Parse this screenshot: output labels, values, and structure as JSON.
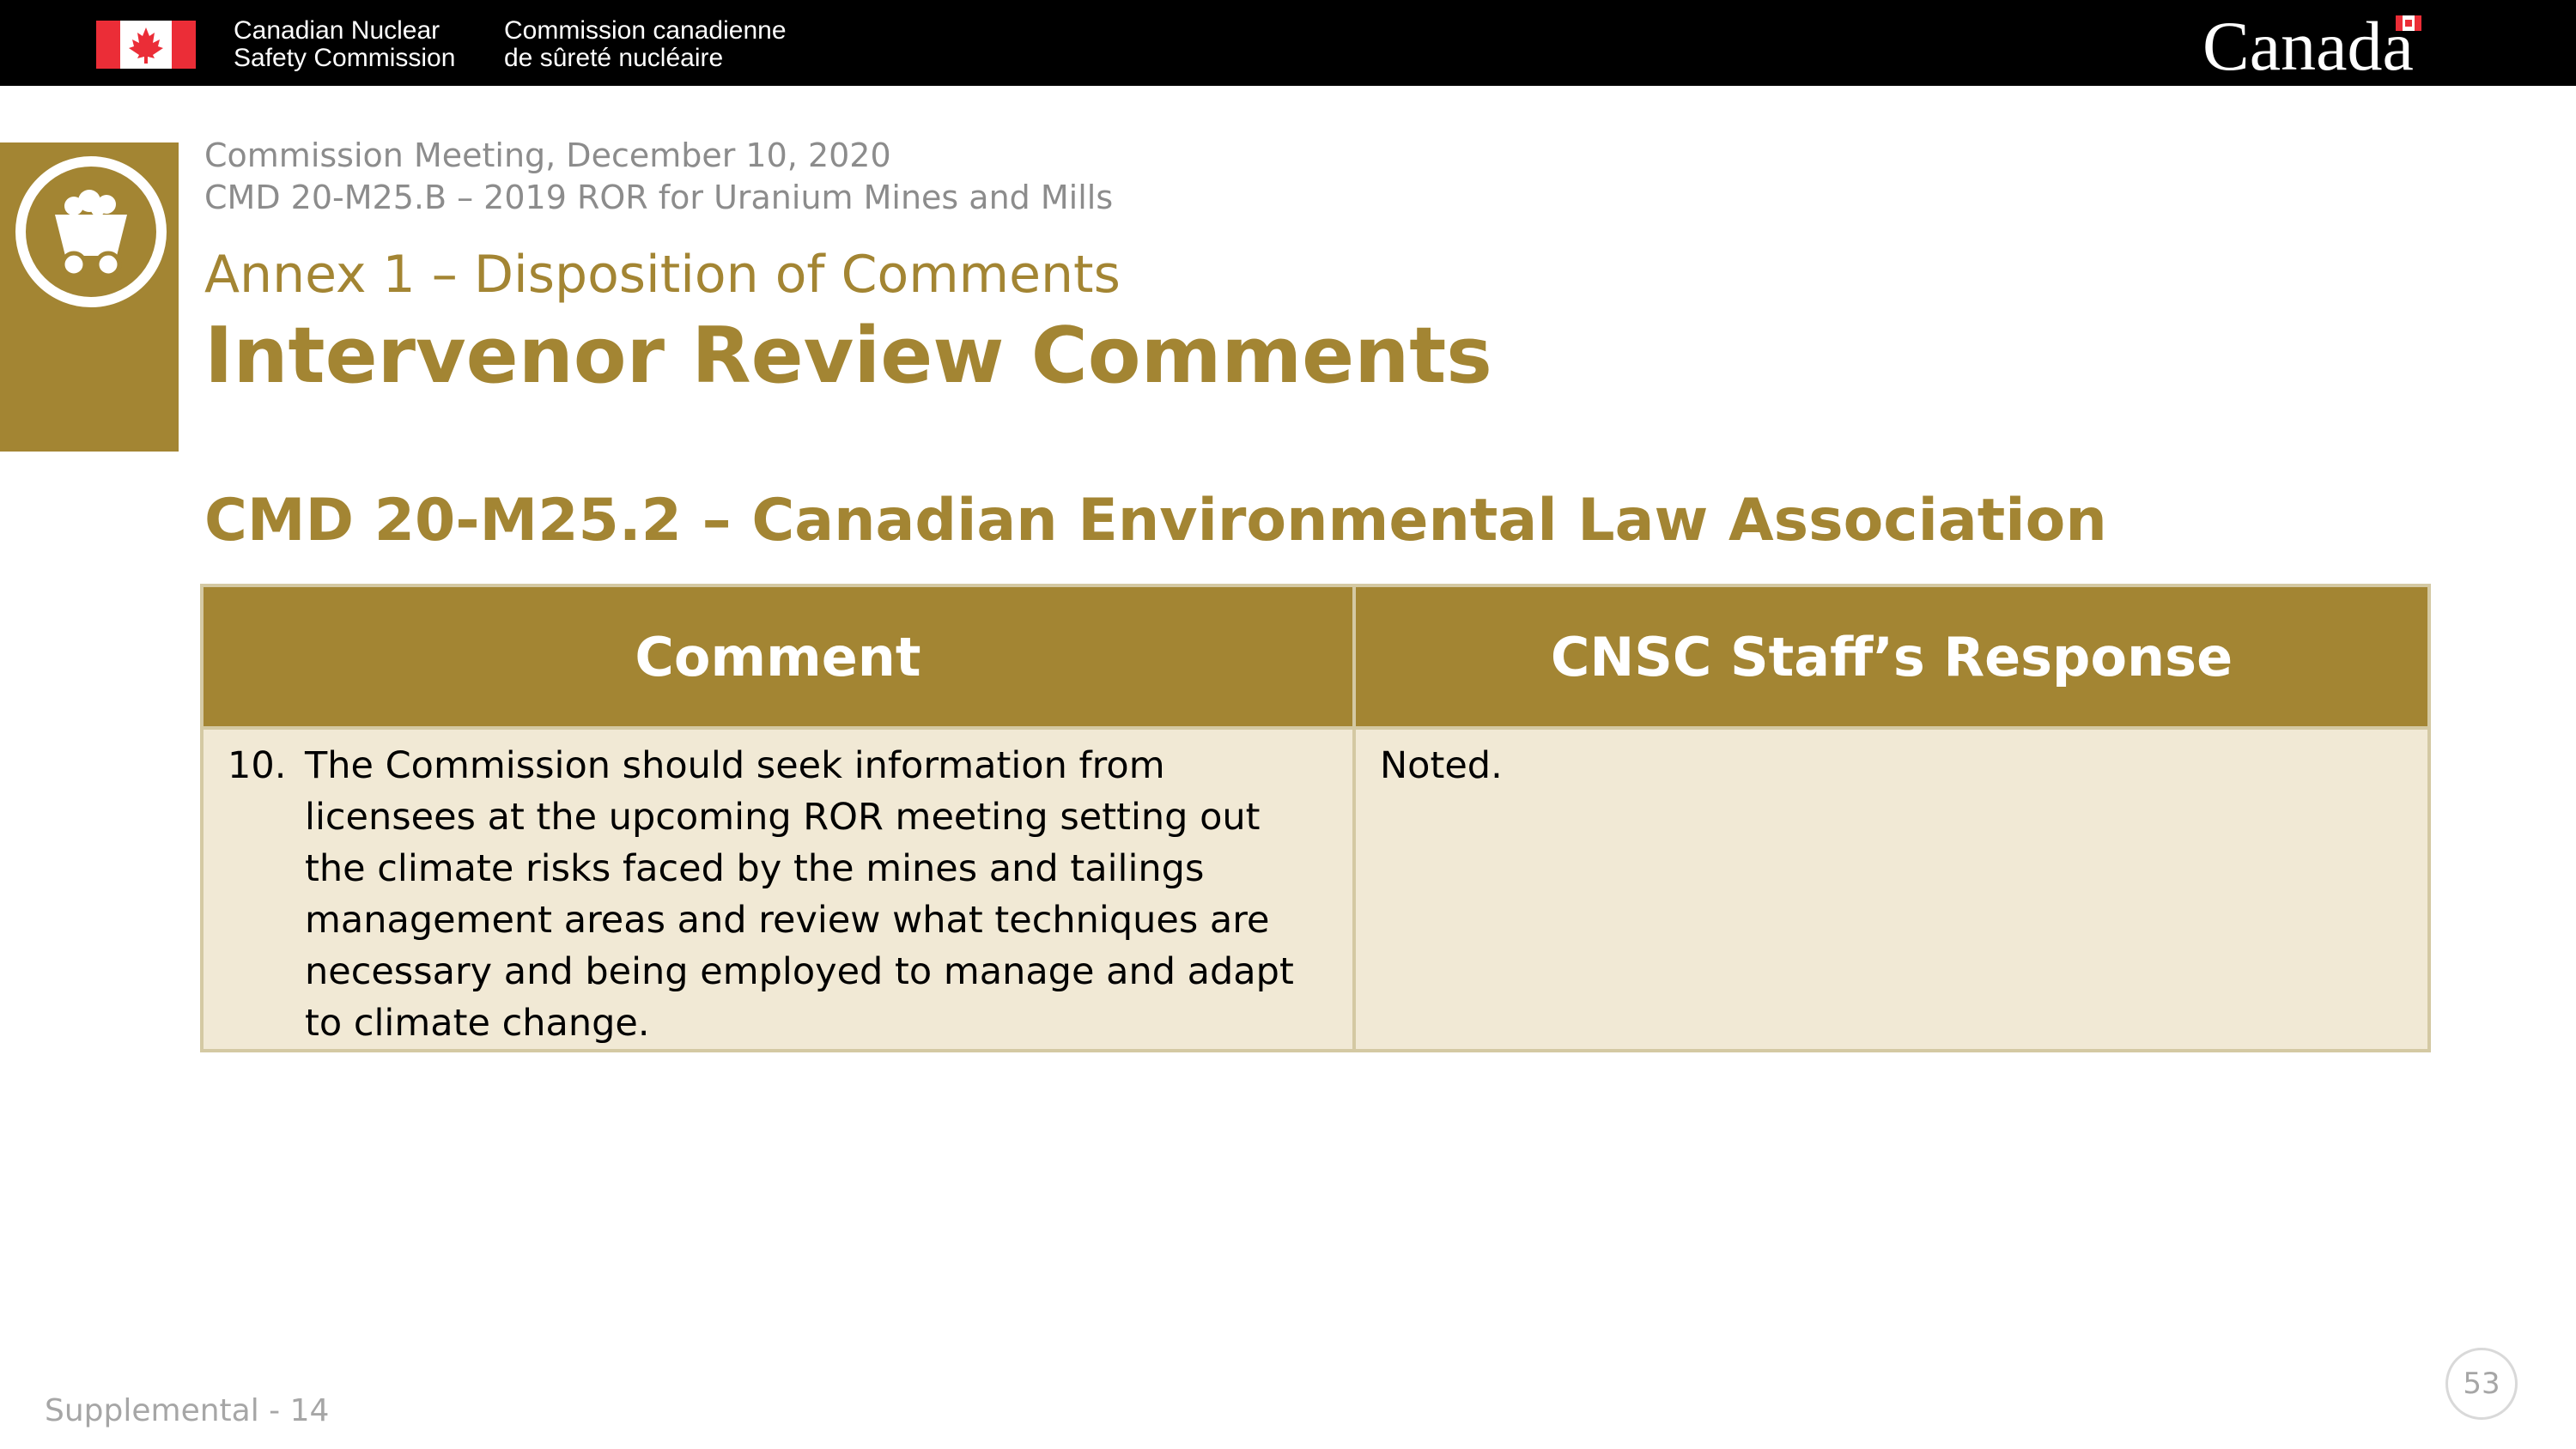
{
  "header": {
    "org_name_en": [
      "Canadian Nuclear",
      "Safety Commission"
    ],
    "org_name_fr": [
      "Commission canadienne",
      "de sûreté nucléaire"
    ],
    "wordmark": "Canada"
  },
  "slide": {
    "meeting": "Commission Meeting, December 10, 2020",
    "document_ref": "CMD 20-M25.B – 2019 ROR for Uranium Mines and Mills",
    "annex": "Annex 1 – Disposition of Comments",
    "title": "Intervenor Review Comments",
    "subtitle": "CMD 20-M25.2 – Canadian Environmental Law Association",
    "side_icon": "mine-cart-icon"
  },
  "table": {
    "headers": [
      "Comment",
      "CNSC Staff’s Response"
    ],
    "rows": [
      {
        "number": "10.",
        "comment": "The Commission should seek information from licensees at the upcoming ROR meeting setting out the climate risks faced by the mines and tailings management areas and review what techniques are necessary and being employed to manage and adapt to climate change.",
        "response": "Noted."
      }
    ]
  },
  "footer": {
    "label": "Supplemental - 14",
    "page_number": "53"
  },
  "colors": {
    "accent": "#a38533",
    "table_body": "#f1e9d5",
    "flag_red": "#eb2d37"
  }
}
